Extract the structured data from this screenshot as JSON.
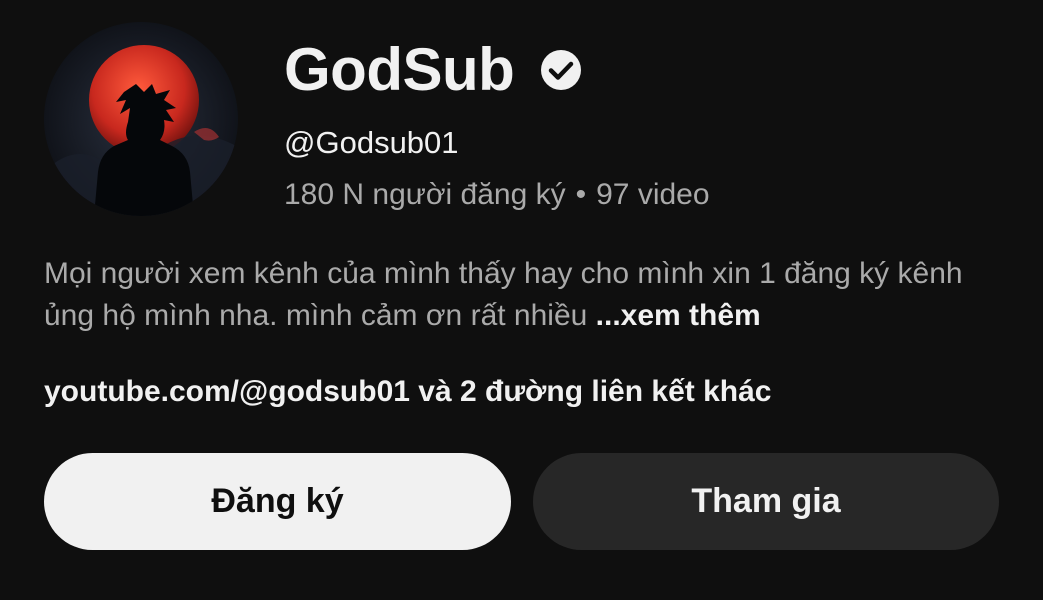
{
  "channel": {
    "name": "GodSub",
    "verified_icon": "verified-check-icon",
    "handle": "@Godsub01",
    "subscribers": "180 N người đăng ký",
    "separator": "•",
    "videos": "97 video",
    "avatar_icon": "channel-avatar-silhouette"
  },
  "description": {
    "text": "Mọi người xem kênh của mình thấy hay cho mình xin 1 đăng ký kênh ủng hộ mình nha. mình cảm ơn rất nhiều",
    "more_label": "...xem thêm"
  },
  "links": {
    "text": "youtube.com/@godsub01 và 2 đường liên kết khác"
  },
  "actions": {
    "subscribe_label": "Đăng ký",
    "join_label": "Tham gia"
  },
  "colors": {
    "background": "#0f0f0f",
    "primary_text": "#f1f1f1",
    "secondary_text": "#aaaaaa",
    "subscribe_bg": "#f1f1f1",
    "join_bg": "#272727",
    "avatar_moon": "#c8281e"
  }
}
